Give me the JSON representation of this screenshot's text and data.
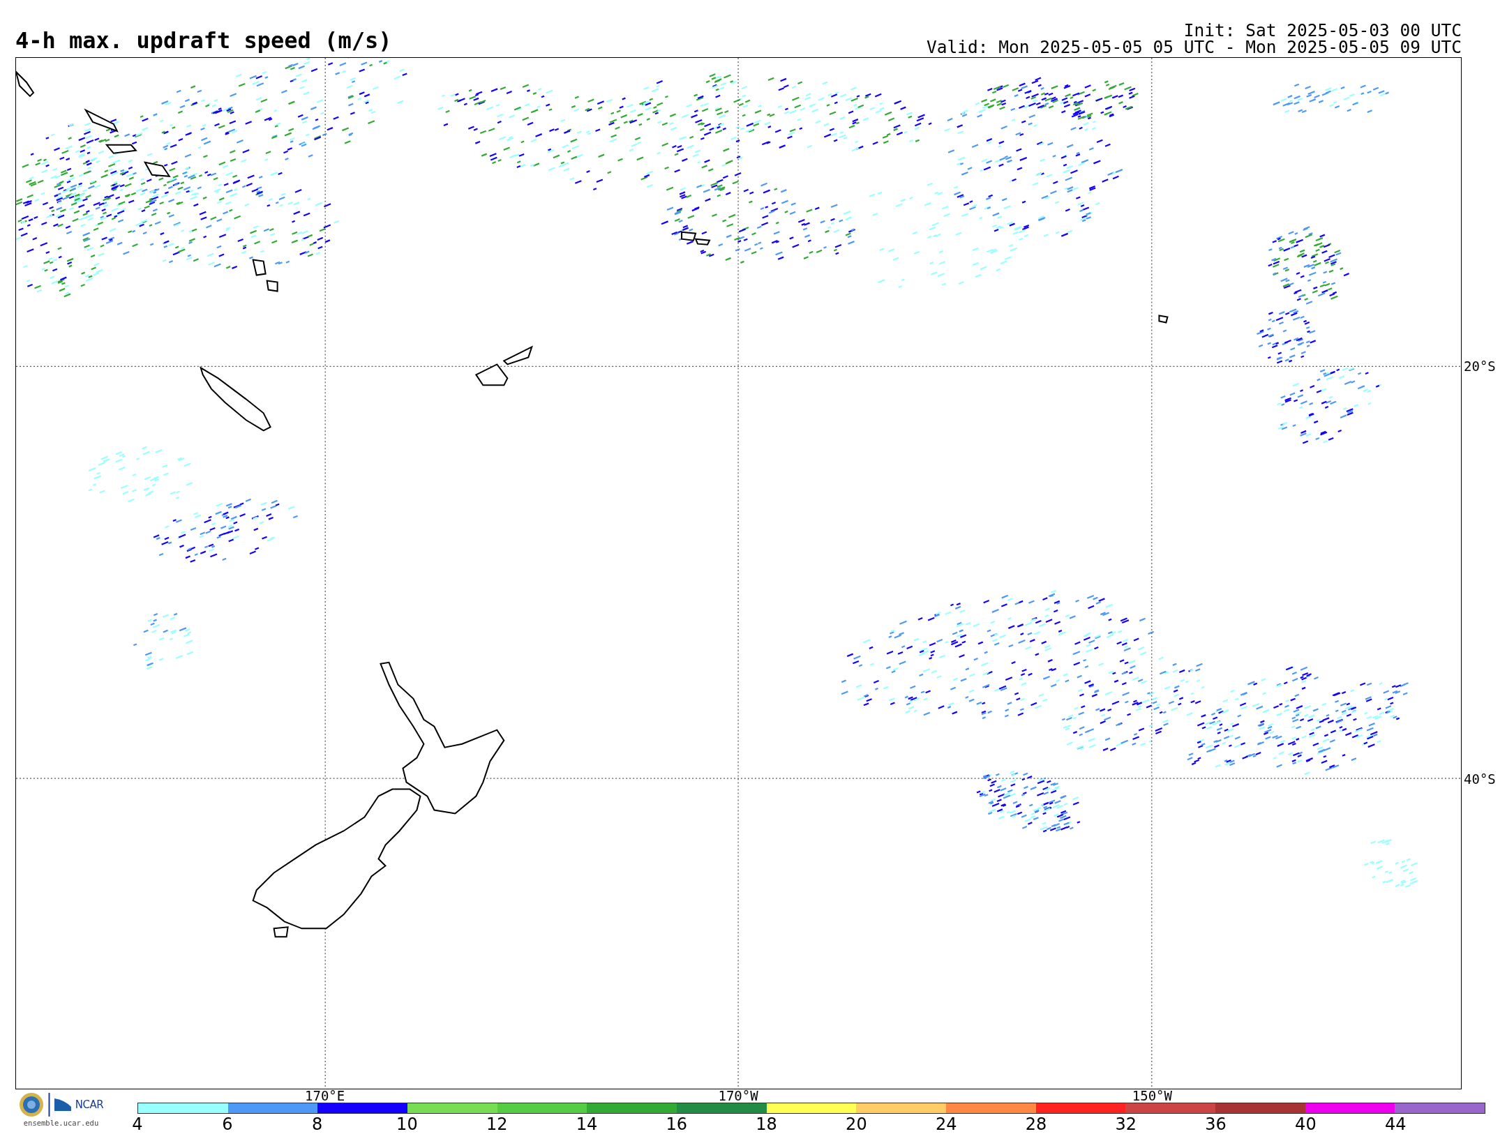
{
  "title": "4-h max. updraft speed (m/s)",
  "init": "Init: Sat 2025-05-03 00 UTC",
  "valid": "Valid: Mon 2025-05-05 05 UTC - Mon 2025-05-05 09 UTC",
  "lat_labels": [
    "20°S",
    "40°S"
  ],
  "lon_labels": [
    "170°E",
    "170°W",
    "150°W"
  ],
  "logo": {
    "org": "NCAR",
    "site": "ensemble.ucar.edu"
  },
  "colorbar": {
    "bins": [
      {
        "color": "#99ffff"
      },
      {
        "color": "#4d99f5"
      },
      {
        "color": "#1400ff"
      },
      {
        "color": "#77dd55"
      },
      {
        "color": "#55cc44"
      },
      {
        "color": "#33aa33"
      },
      {
        "color": "#228b44"
      },
      {
        "color": "#ffff55"
      },
      {
        "color": "#ffcc66"
      },
      {
        "color": "#ff8844"
      },
      {
        "color": "#ff2222"
      },
      {
        "color": "#cc4444"
      },
      {
        "color": "#a83333"
      },
      {
        "color": "#ee00ee"
      },
      {
        "color": "#9966cc"
      }
    ],
    "ticks": [
      "4",
      "6",
      "8",
      "10",
      "12",
      "14",
      "16",
      "18",
      "20",
      "24",
      "28",
      "32",
      "36",
      "40",
      "44"
    ]
  }
}
